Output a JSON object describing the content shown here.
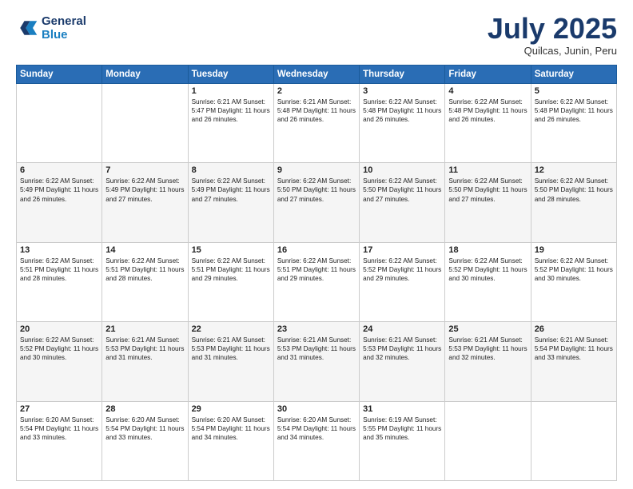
{
  "header": {
    "logo_line1": "General",
    "logo_line2": "Blue",
    "month": "July 2025",
    "location": "Quilcas, Junin, Peru"
  },
  "days_of_week": [
    "Sunday",
    "Monday",
    "Tuesday",
    "Wednesday",
    "Thursday",
    "Friday",
    "Saturday"
  ],
  "weeks": [
    [
      {
        "day": "",
        "content": ""
      },
      {
        "day": "",
        "content": ""
      },
      {
        "day": "1",
        "content": "Sunrise: 6:21 AM\nSunset: 5:47 PM\nDaylight: 11 hours and 26 minutes."
      },
      {
        "day": "2",
        "content": "Sunrise: 6:21 AM\nSunset: 5:48 PM\nDaylight: 11 hours and 26 minutes."
      },
      {
        "day": "3",
        "content": "Sunrise: 6:22 AM\nSunset: 5:48 PM\nDaylight: 11 hours and 26 minutes."
      },
      {
        "day": "4",
        "content": "Sunrise: 6:22 AM\nSunset: 5:48 PM\nDaylight: 11 hours and 26 minutes."
      },
      {
        "day": "5",
        "content": "Sunrise: 6:22 AM\nSunset: 5:48 PM\nDaylight: 11 hours and 26 minutes."
      }
    ],
    [
      {
        "day": "6",
        "content": "Sunrise: 6:22 AM\nSunset: 5:49 PM\nDaylight: 11 hours and 26 minutes."
      },
      {
        "day": "7",
        "content": "Sunrise: 6:22 AM\nSunset: 5:49 PM\nDaylight: 11 hours and 27 minutes."
      },
      {
        "day": "8",
        "content": "Sunrise: 6:22 AM\nSunset: 5:49 PM\nDaylight: 11 hours and 27 minutes."
      },
      {
        "day": "9",
        "content": "Sunrise: 6:22 AM\nSunset: 5:50 PM\nDaylight: 11 hours and 27 minutes."
      },
      {
        "day": "10",
        "content": "Sunrise: 6:22 AM\nSunset: 5:50 PM\nDaylight: 11 hours and 27 minutes."
      },
      {
        "day": "11",
        "content": "Sunrise: 6:22 AM\nSunset: 5:50 PM\nDaylight: 11 hours and 27 minutes."
      },
      {
        "day": "12",
        "content": "Sunrise: 6:22 AM\nSunset: 5:50 PM\nDaylight: 11 hours and 28 minutes."
      }
    ],
    [
      {
        "day": "13",
        "content": "Sunrise: 6:22 AM\nSunset: 5:51 PM\nDaylight: 11 hours and 28 minutes."
      },
      {
        "day": "14",
        "content": "Sunrise: 6:22 AM\nSunset: 5:51 PM\nDaylight: 11 hours and 28 minutes."
      },
      {
        "day": "15",
        "content": "Sunrise: 6:22 AM\nSunset: 5:51 PM\nDaylight: 11 hours and 29 minutes."
      },
      {
        "day": "16",
        "content": "Sunrise: 6:22 AM\nSunset: 5:51 PM\nDaylight: 11 hours and 29 minutes."
      },
      {
        "day": "17",
        "content": "Sunrise: 6:22 AM\nSunset: 5:52 PM\nDaylight: 11 hours and 29 minutes."
      },
      {
        "day": "18",
        "content": "Sunrise: 6:22 AM\nSunset: 5:52 PM\nDaylight: 11 hours and 30 minutes."
      },
      {
        "day": "19",
        "content": "Sunrise: 6:22 AM\nSunset: 5:52 PM\nDaylight: 11 hours and 30 minutes."
      }
    ],
    [
      {
        "day": "20",
        "content": "Sunrise: 6:22 AM\nSunset: 5:52 PM\nDaylight: 11 hours and 30 minutes."
      },
      {
        "day": "21",
        "content": "Sunrise: 6:21 AM\nSunset: 5:53 PM\nDaylight: 11 hours and 31 minutes."
      },
      {
        "day": "22",
        "content": "Sunrise: 6:21 AM\nSunset: 5:53 PM\nDaylight: 11 hours and 31 minutes."
      },
      {
        "day": "23",
        "content": "Sunrise: 6:21 AM\nSunset: 5:53 PM\nDaylight: 11 hours and 31 minutes."
      },
      {
        "day": "24",
        "content": "Sunrise: 6:21 AM\nSunset: 5:53 PM\nDaylight: 11 hours and 32 minutes."
      },
      {
        "day": "25",
        "content": "Sunrise: 6:21 AM\nSunset: 5:53 PM\nDaylight: 11 hours and 32 minutes."
      },
      {
        "day": "26",
        "content": "Sunrise: 6:21 AM\nSunset: 5:54 PM\nDaylight: 11 hours and 33 minutes."
      }
    ],
    [
      {
        "day": "27",
        "content": "Sunrise: 6:20 AM\nSunset: 5:54 PM\nDaylight: 11 hours and 33 minutes."
      },
      {
        "day": "28",
        "content": "Sunrise: 6:20 AM\nSunset: 5:54 PM\nDaylight: 11 hours and 33 minutes."
      },
      {
        "day": "29",
        "content": "Sunrise: 6:20 AM\nSunset: 5:54 PM\nDaylight: 11 hours and 34 minutes."
      },
      {
        "day": "30",
        "content": "Sunrise: 6:20 AM\nSunset: 5:54 PM\nDaylight: 11 hours and 34 minutes."
      },
      {
        "day": "31",
        "content": "Sunrise: 6:19 AM\nSunset: 5:55 PM\nDaylight: 11 hours and 35 minutes."
      },
      {
        "day": "",
        "content": ""
      },
      {
        "day": "",
        "content": ""
      }
    ]
  ]
}
